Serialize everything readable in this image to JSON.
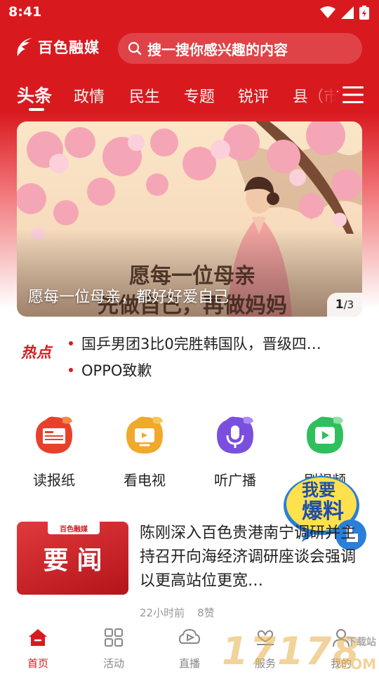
{
  "status": {
    "time": "8:41"
  },
  "header": {
    "logo_text": "百色融媒",
    "search_placeholder": "搜一搜你感兴趣的内容"
  },
  "tabs": [
    {
      "label": "头条",
      "active": true
    },
    {
      "label": "政情"
    },
    {
      "label": "民生"
    },
    {
      "label": "专题"
    },
    {
      "label": "锐评"
    },
    {
      "label": "县（市"
    }
  ],
  "banner": {
    "caption": "愿每一位母亲，都好好爱自己",
    "image_text_line1": "愿每一位母亲",
    "image_text_line2": "先做自己，再做妈妈",
    "counter_current": "1",
    "counter_total": "/3"
  },
  "hot": {
    "label": "热点",
    "items": [
      "国乒男团3比0完胜韩国队，晋级四…",
      "OPPO致歉"
    ]
  },
  "quick_entries": [
    {
      "label": "读报纸",
      "icon": "newspaper-icon",
      "color": "#e8402b"
    },
    {
      "label": "看电视",
      "icon": "tv-icon",
      "color": "#f0a92a"
    },
    {
      "label": "听广播",
      "icon": "microphone-icon",
      "color": "#7a4fe0"
    },
    {
      "label": "刷视频",
      "icon": "video-play-icon",
      "color": "#2fbf5c"
    }
  ],
  "float_badge": {
    "line1": "我要",
    "line2": "爆料"
  },
  "news": {
    "thumb_tag": "百色融媒",
    "thumb_title": "要闻",
    "title": "陈刚深入百色贵港南宁调研并主持召开向海经济调研座谈会强调 以更高站位更宽…",
    "time": "22小时前",
    "likes": "8赞"
  },
  "bottom_nav": [
    {
      "label": "首页",
      "icon": "home-icon",
      "active": true
    },
    {
      "label": "活动",
      "icon": "grid-icon"
    },
    {
      "label": "直播",
      "icon": "live-play-icon"
    },
    {
      "label": "服务",
      "icon": "service-heart-icon"
    },
    {
      "label": "我的",
      "icon": "user-icon"
    }
  ],
  "watermark": {
    "text": "17178",
    "sub": "下载站",
    "domain": ".COM"
  },
  "colors": {
    "brand_red": "#d81a1f",
    "muted": "#888888"
  }
}
